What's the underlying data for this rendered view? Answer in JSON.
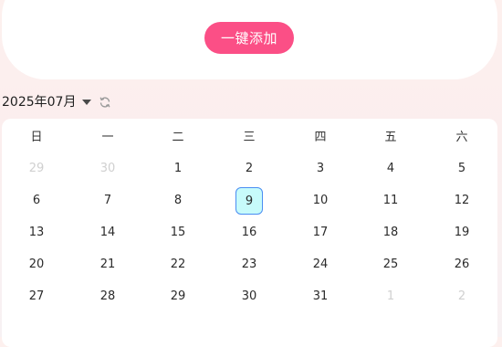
{
  "top": {
    "add_button_label": "一键添加"
  },
  "calendar": {
    "month_label": "2025年07月",
    "weekdays": [
      "日",
      "一",
      "二",
      "三",
      "四",
      "五",
      "六"
    ],
    "weeks": [
      [
        {
          "d": "29",
          "m": true
        },
        {
          "d": "30",
          "m": true
        },
        {
          "d": "1"
        },
        {
          "d": "2"
        },
        {
          "d": "3"
        },
        {
          "d": "4"
        },
        {
          "d": "5"
        }
      ],
      [
        {
          "d": "6"
        },
        {
          "d": "7"
        },
        {
          "d": "8"
        },
        {
          "d": "9",
          "sel": true
        },
        {
          "d": "10"
        },
        {
          "d": "11"
        },
        {
          "d": "12"
        }
      ],
      [
        {
          "d": "13"
        },
        {
          "d": "14"
        },
        {
          "d": "15"
        },
        {
          "d": "16"
        },
        {
          "d": "17"
        },
        {
          "d": "18"
        },
        {
          "d": "19"
        }
      ],
      [
        {
          "d": "20"
        },
        {
          "d": "21"
        },
        {
          "d": "22"
        },
        {
          "d": "23"
        },
        {
          "d": "24"
        },
        {
          "d": "25"
        },
        {
          "d": "26"
        }
      ],
      [
        {
          "d": "27"
        },
        {
          "d": "28"
        },
        {
          "d": "29"
        },
        {
          "d": "30"
        },
        {
          "d": "31"
        },
        {
          "d": "1",
          "m": true
        },
        {
          "d": "2",
          "m": true
        }
      ]
    ],
    "selected_day": "9"
  },
  "icons": {
    "dropdown": "caret-down-icon",
    "refresh": "refresh-icon"
  },
  "colors": {
    "accent_button": "#fb4f86",
    "selected_fill": "#c7fbfb",
    "selected_border": "#4a8df2",
    "muted_day": "#d0d0d0"
  }
}
